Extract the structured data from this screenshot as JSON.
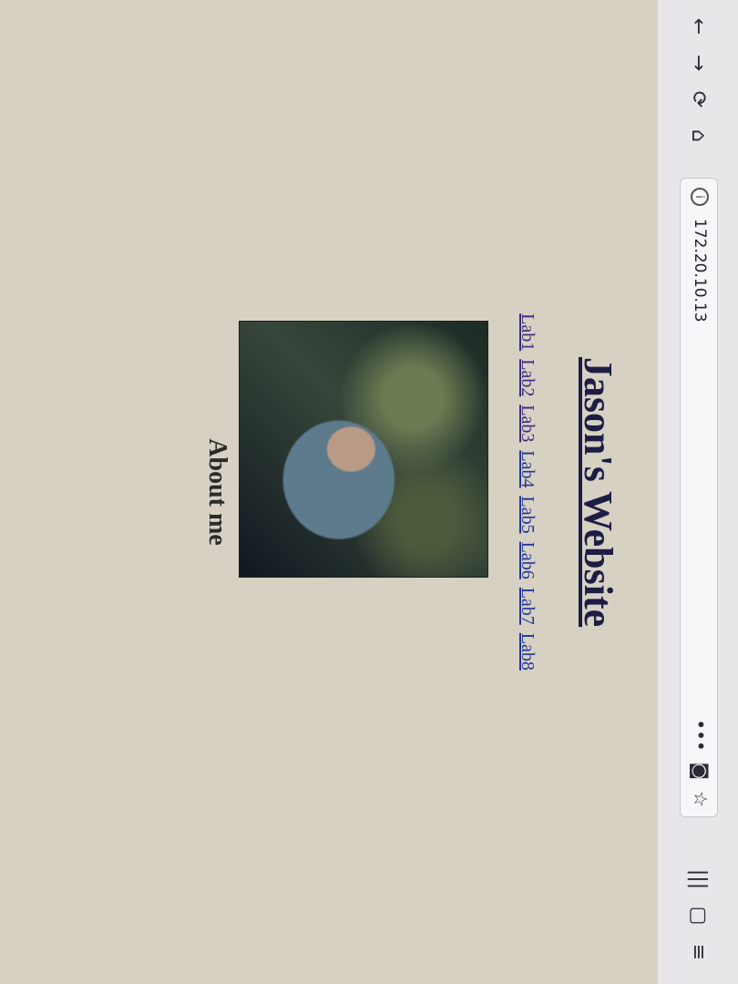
{
  "browser": {
    "url": "172.20.10.13",
    "icons": [
      "back-icon",
      "reload-icon",
      "home-icon",
      "info-icon",
      "more-icon",
      "pocket-icon",
      "star-icon",
      "library-icon",
      "sidebar-icon",
      "menu-icon"
    ],
    "more_glyph": "•••"
  },
  "page": {
    "heading": "Jason's Website",
    "nav": [
      "Lab1",
      "Lab2",
      "Lab3",
      "Lab4",
      "Lab5",
      "Lab6",
      "Lab7",
      "Lab8"
    ],
    "section_title": "About me"
  },
  "colors": {
    "link": "#233497",
    "heading": "#1d1d44"
  }
}
